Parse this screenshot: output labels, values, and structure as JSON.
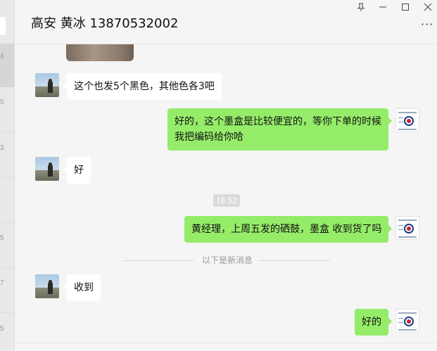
{
  "window": {
    "title": "高安 黄冰 13870532002",
    "pin_glyph": "⊥",
    "minimize_glyph": "—",
    "maximize_glyph": "☐",
    "close_glyph": "✕",
    "more_glyph": "···"
  },
  "left_strip": {
    "marks": [
      "4",
      "5",
      "3",
      "5",
      "7",
      "5"
    ]
  },
  "messages": [
    {
      "from": "peer",
      "text": "这个也发5个黑色，其他色各3吧"
    },
    {
      "from": "me",
      "lines": [
        "好的，这个墨盒是比较便宜的，等你下单的时候",
        "我把编码给你哈"
      ]
    },
    {
      "from": "peer",
      "text": "好"
    },
    {
      "type": "time",
      "text": "16:52"
    },
    {
      "from": "me",
      "text": "黄经理，上周五发的硒鼓，墨盒 收到货了吗"
    },
    {
      "type": "divider",
      "text": "以下是新消息"
    },
    {
      "from": "peer",
      "text": "收到"
    },
    {
      "from": "me",
      "text": "好的"
    }
  ]
}
